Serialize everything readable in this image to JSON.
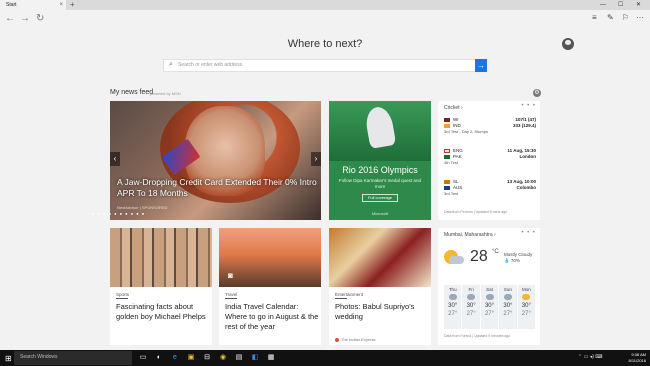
{
  "browser": {
    "tab_title": "Start",
    "tab_close": "×",
    "new_tab": "+",
    "min": "—",
    "max": "☐",
    "close": "✕"
  },
  "nav": {
    "back": "←",
    "forward": "→",
    "refresh": "↻",
    "hub": "≡",
    "note": "✎",
    "share": "⚐",
    "more": "···"
  },
  "hero": {
    "heading": "Where to next?",
    "search_placeholder": "Search or enter web address",
    "search_go": "→"
  },
  "feed": {
    "title": "My news feed",
    "powered": "powered by MSN",
    "gear": "⚙"
  },
  "main_story": {
    "headline": "A Jaw-Dropping Credit Card Extended Their 0% Intro APR To 18 Months",
    "source": "NextAdvisor | SPONSORED",
    "dots": "● ● ● ● ● ● ● ● ● ●",
    "prev": "‹",
    "next": "›"
  },
  "olympics": {
    "title": "Rio 2016 Olympics",
    "subtitle": "Follow Dipa Karmakar's medal quest and more",
    "button": "Full coverage",
    "brand": "Microsoft"
  },
  "cricket": {
    "heading": "Cricket ›",
    "more": "• • •",
    "matches": [
      {
        "team1": "WI",
        "score1": "107/1 (47)",
        "team2": "IND",
        "score2": "333 (129.4)",
        "status": "3rd Test - Day 2, Stumps"
      },
      {
        "team1": "ENG",
        "score1": "11 Aug, 15:30",
        "team2": "PAK",
        "score2": "London",
        "status": "4th Test"
      },
      {
        "team1": "SL",
        "score1": "13 Aug, 10:00",
        "team2": "AUS",
        "score2": "Colombo",
        "status": "3rd Test"
      }
    ],
    "footer": "Data from Perform | Updated 8 mins ago",
    "flag_colors": {
      "WI": "#7a1f2b",
      "IND": "#ff9933",
      "ENG": "#d0d0d0",
      "PAK": "#1d6b2e",
      "SL": "#c87a00",
      "AUS": "#1a3d8f"
    }
  },
  "stories": [
    {
      "category": "Sports",
      "title": "Fascinating facts about golden boy Michael Phelps"
    },
    {
      "category": "Travel",
      "title": "India Travel Calendar: Where to go in August & the rest of the year"
    },
    {
      "category": "Entertainment",
      "title": "Photos: Babul Supriyo's wedding",
      "source": "The Indian Express"
    }
  ],
  "weather": {
    "location": "Mumbai, Maharashtra ›",
    "more": "• • •",
    "temp": "28",
    "unit": "°C",
    "condition": "Mostly Cloudy",
    "humidity": "💧 70%",
    "forecast": [
      {
        "day": "Thu",
        "hi": "30°",
        "lo": "27°"
      },
      {
        "day": "Fri",
        "hi": "30°",
        "lo": "27°"
      },
      {
        "day": "Sat",
        "hi": "30°",
        "lo": "27°"
      },
      {
        "day": "Sun",
        "hi": "30°",
        "lo": "27°"
      },
      {
        "day": "Mon",
        "hi": "30°",
        "lo": "27°"
      }
    ],
    "footer": "Data from Foreca | Updated 9 minutes ago"
  },
  "taskbar": {
    "start": "⊞",
    "search": "Search Windows",
    "icons": [
      "▭",
      "◐",
      "e",
      "▣",
      "⊟",
      "◉",
      "▤",
      "◧",
      "▦"
    ],
    "time": "9:38 AM",
    "date": "8/11/2016"
  }
}
